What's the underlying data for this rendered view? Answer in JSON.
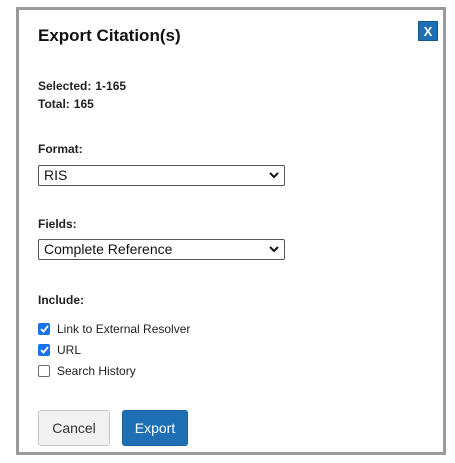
{
  "dialog": {
    "title": "Export Citation(s)",
    "close_label": "X"
  },
  "selection": {
    "selected_label": "Selected:",
    "selected_value": "1-165",
    "total_label": "Total:",
    "total_value": "165"
  },
  "format": {
    "label": "Format:",
    "selected": "RIS"
  },
  "fields": {
    "label": "Fields:",
    "selected": "Complete Reference"
  },
  "include": {
    "label": "Include:",
    "options": [
      {
        "label": "Link to External Resolver",
        "checked": true
      },
      {
        "label": "URL",
        "checked": true
      },
      {
        "label": "Search History",
        "checked": false
      }
    ]
  },
  "actions": {
    "cancel_label": "Cancel",
    "export_label": "Export"
  },
  "colors": {
    "accent": "#1f6fb5",
    "checkbox": "#1a73e8",
    "border": "#9a9a9a"
  },
  "icons": {
    "select_arrow": "chevron-down-icon",
    "check": "checkmark-icon"
  }
}
